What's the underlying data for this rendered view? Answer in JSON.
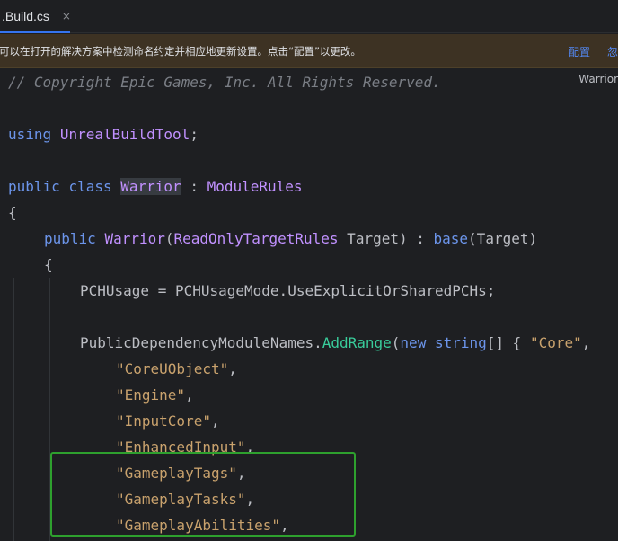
{
  "tab": {
    "label": ".Build.cs",
    "close": "×"
  },
  "notice": {
    "message": "可以在打开的解决方案中检测命名约定并相应地更新设置。点击“配置”以更改。",
    "configure": "配置",
    "dismiss": "忽"
  },
  "inlay_hint": "Warrior",
  "lines": {
    "l1": {
      "comment": "// Copyright Epic Games, Inc. All Rights Reserved."
    },
    "l3": {
      "kw": "using",
      "ns": "UnrealBuildTool",
      "semi": ";"
    },
    "l5": {
      "kw1": "public",
      "kw2": "class",
      "name": "Warrior",
      "colon": " : ",
      "base": "ModuleRules"
    },
    "l6": {
      "brace": "{"
    },
    "l7": {
      "kw": "public",
      "ctor": "Warrior",
      "open": "(",
      "ptype": "ReadOnlyTargetRules",
      "pname": " Target) : ",
      "basekw": "base",
      "rest": "(Target)"
    },
    "l8": {
      "brace": "{"
    },
    "l9": {
      "text": "PCHUsage = PCHUsageMode.UseExplicitOrSharedPCHs;"
    },
    "l11": {
      "prop": "PublicDependencyModuleNames.",
      "method": "AddRange",
      "open": "(",
      "kw": "new",
      "type": "string",
      "rest": "[] { ",
      "first": "\"Core\"",
      "comma": ","
    }
  },
  "modules": [
    "\"CoreUObject\"",
    "\"Engine\"",
    "\"InputCore\"",
    "\"EnhancedInput\"",
    "\"GameplayTags\"",
    "\"GameplayTasks\"",
    "\"GameplayAbilities\""
  ],
  "colors": {
    "keyword": "#6c95eb",
    "type": "#c191ff",
    "method": "#39cc9b",
    "string": "#c9a26d",
    "comment": "#7a7e85",
    "highlight_box": "#2ea02e"
  }
}
